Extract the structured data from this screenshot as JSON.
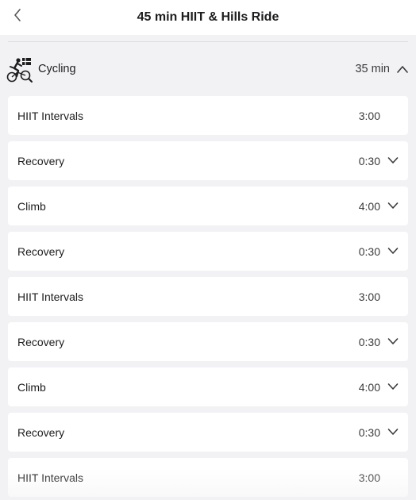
{
  "header": {
    "title": "45 min HIIT & Hills Ride",
    "back_icon": "chevron-left-icon"
  },
  "section": {
    "label": "Cycling",
    "duration": "35 min",
    "icon": "cycling-icon",
    "expanded": true
  },
  "intervals": [
    {
      "label": "HIIT Intervals",
      "duration": "3:00",
      "expandable": false
    },
    {
      "label": "Recovery",
      "duration": "0:30",
      "expandable": true
    },
    {
      "label": "Climb",
      "duration": "4:00",
      "expandable": true
    },
    {
      "label": "Recovery",
      "duration": "0:30",
      "expandable": true
    },
    {
      "label": "HIIT Intervals",
      "duration": "3:00",
      "expandable": false
    },
    {
      "label": "Recovery",
      "duration": "0:30",
      "expandable": true
    },
    {
      "label": "Climb",
      "duration": "4:00",
      "expandable": true
    },
    {
      "label": "Recovery",
      "duration": "0:30",
      "expandable": true
    },
    {
      "label": "HIIT Intervals",
      "duration": "3:00",
      "expandable": false
    }
  ],
  "colors": {
    "background": "#f2f2f4",
    "card": "#ffffff",
    "text": "#1d1d1f",
    "secondary_text": "#3a3a3c"
  }
}
